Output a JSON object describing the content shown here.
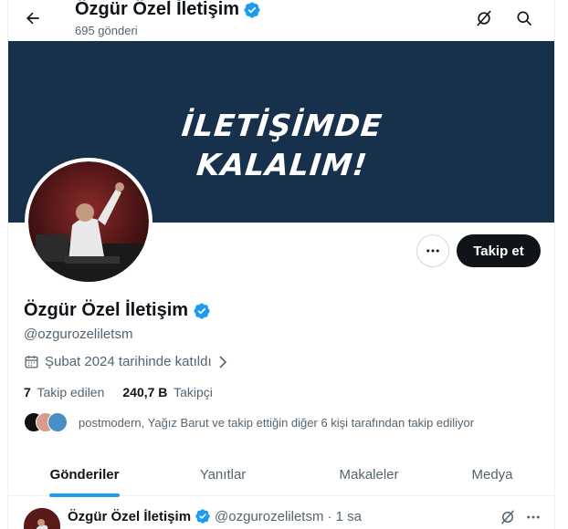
{
  "header": {
    "title": "Özgür Özel İletişim",
    "posts_count": "695 gönderi",
    "icons": [
      "back-arrow-icon",
      "grok-icon",
      "search-icon"
    ]
  },
  "banner": {
    "line1": "İLETİŞİMDE",
    "line2": "KALALIM!",
    "background_color": "#17314c"
  },
  "profile": {
    "name": "Özgür Özel İletişim",
    "handle": "@ozgurozeliletsm",
    "joined": "Şubat 2024 tarihinde katıldı",
    "following_count": "7",
    "following_label": "Takip edilen",
    "followers_count": "240,7 B",
    "followers_label": "Takipçi",
    "followed_by_text": "postmodern, Yağız Barut ve takip ettiğin diğer 6 kişi tarafından takip ediliyor",
    "verified_color": "#1d9bf0"
  },
  "actions": {
    "follow_label": "Takip et"
  },
  "tabs": [
    {
      "label": "Gönderiler",
      "active": true
    },
    {
      "label": "Yanıtlar",
      "active": false
    },
    {
      "label": "Makaleler",
      "active": false
    },
    {
      "label": "Medya",
      "active": false
    }
  ],
  "tweet": {
    "name": "Özgür Özel İletişim",
    "handle": "@ozgurozeliletsm",
    "time": "· 1 sa"
  },
  "colors": {
    "accent": "#1d9bf0",
    "text_primary": "#0f1419",
    "text_secondary": "#536471"
  }
}
